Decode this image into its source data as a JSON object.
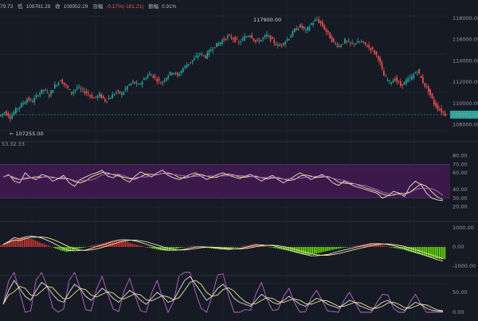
{
  "header": {
    "fragment": "79.73",
    "low_label": "低",
    "low": "108781.28",
    "close_label": "收",
    "close": "108952.29",
    "change_label": "涨幅",
    "change": "-0.17%(-181.21)",
    "amp_label": "振幅",
    "amp": "0.91%"
  },
  "annotations": {
    "high": "117900.00",
    "low": "← 107255.00",
    "last_price": "108952.29",
    "rsi_fragment": "53.32.33"
  },
  "price_axis": [
    "118000.00",
    "116000.00",
    "114000.00",
    "112000.00",
    "110000.00",
    "108000.00"
  ],
  "rsi_axis": [
    "80.00",
    "70.00",
    "60.00",
    "40.00",
    "30.00",
    "20.00"
  ],
  "macd_axis": [
    "1000.00",
    "0.00",
    "-1000.00"
  ],
  "kdj_axis": [
    "50.00",
    "0.00"
  ],
  "colors": {
    "up": "#26a69a",
    "down": "#ef5350",
    "bg": "#161a25",
    "rsi_band": "#3f1a4f",
    "macd_pos": "#e53935",
    "macd_neg": "#76ff03",
    "line_yellow": "#f0e68c",
    "line_white": "#e0e0e0",
    "line_purple": "#ba68c8"
  },
  "chart_data": {
    "type": "candlestick",
    "price_ylim": [
      107255,
      117900
    ],
    "price_path": [
      108800,
      109200,
      108700,
      109400,
      109900,
      110400,
      110200,
      110900,
      111300,
      110800,
      111700,
      112200,
      111600,
      111000,
      111500,
      111200,
      110900,
      110500,
      110800,
      110300,
      110600,
      111100,
      110900,
      111600,
      112000,
      111700,
      112300,
      112800,
      112400,
      111900,
      112500,
      113000,
      112600,
      113300,
      113800,
      114200,
      114700,
      114400,
      115100,
      115500,
      115900,
      116300,
      116100,
      115700,
      116200,
      116500,
      115800,
      116000,
      116400,
      115900,
      115400,
      115700,
      116200,
      116900,
      117300,
      116800,
      117500,
      117900,
      117300,
      116500,
      115700,
      115400,
      115900,
      115600,
      115700,
      115800,
      115400,
      115000,
      114300,
      112600,
      112000,
      112300,
      111700,
      112100,
      112500,
      113100,
      112000,
      111200,
      110000,
      109400,
      108952.29
    ],
    "rsi": [
      55,
      58,
      50,
      48,
      60,
      54,
      52,
      58,
      56,
      50,
      53,
      57,
      48,
      44,
      52,
      55,
      58,
      60,
      63,
      56,
      54,
      58,
      52,
      49,
      56,
      61,
      58,
      55,
      60,
      63,
      57,
      54,
      52,
      55,
      58,
      60,
      56,
      52,
      55,
      58,
      60,
      57,
      55,
      53,
      56,
      58,
      54,
      50,
      54,
      57,
      52,
      48,
      52,
      56,
      60,
      56,
      52,
      55,
      58,
      54,
      48,
      45,
      50,
      47,
      44,
      42,
      40,
      38,
      36,
      30,
      33,
      38,
      36,
      32,
      44,
      50,
      46,
      36,
      30,
      28,
      27
    ],
    "macd_hist": [
      100,
      220,
      380,
      460,
      520,
      470,
      380,
      260,
      140,
      40,
      -80,
      -190,
      -260,
      -200,
      -110,
      -40,
      30,
      90,
      150,
      220,
      310,
      360,
      330,
      260,
      170,
      90,
      20,
      -40,
      -110,
      -170,
      -200,
      -150,
      -90,
      -30,
      20,
      50,
      30,
      -20,
      -70,
      -100,
      -130,
      -110,
      -70,
      -20,
      40,
      90,
      160,
      110,
      40,
      -10,
      -70,
      -130,
      -190,
      -260,
      -330,
      -380,
      -420,
      -370,
      -300,
      -230,
      -170,
      -110,
      -60,
      -20,
      30,
      80,
      140,
      190,
      170,
      110,
      40,
      -30,
      -80,
      -130,
      -220,
      -300,
      -380,
      -450,
      -520,
      -600,
      -640
    ],
    "kdj_k": [
      20,
      55,
      80,
      60,
      40,
      30,
      55,
      75,
      65,
      45,
      30,
      25,
      50,
      70,
      60,
      40,
      30,
      45,
      60,
      50,
      35,
      25,
      40,
      55,
      45,
      30,
      20,
      35,
      50,
      40,
      25,
      30,
      55,
      80,
      90,
      70,
      50,
      30,
      40,
      60,
      70,
      55,
      35,
      25,
      20,
      15,
      30,
      45,
      35,
      25,
      20,
      30,
      40,
      30,
      20,
      15,
      25,
      35,
      30,
      20,
      15,
      10,
      20,
      30,
      25,
      15,
      10,
      5,
      15,
      25,
      30,
      20,
      10,
      5,
      15,
      25,
      20,
      10,
      5,
      3,
      2
    ]
  }
}
